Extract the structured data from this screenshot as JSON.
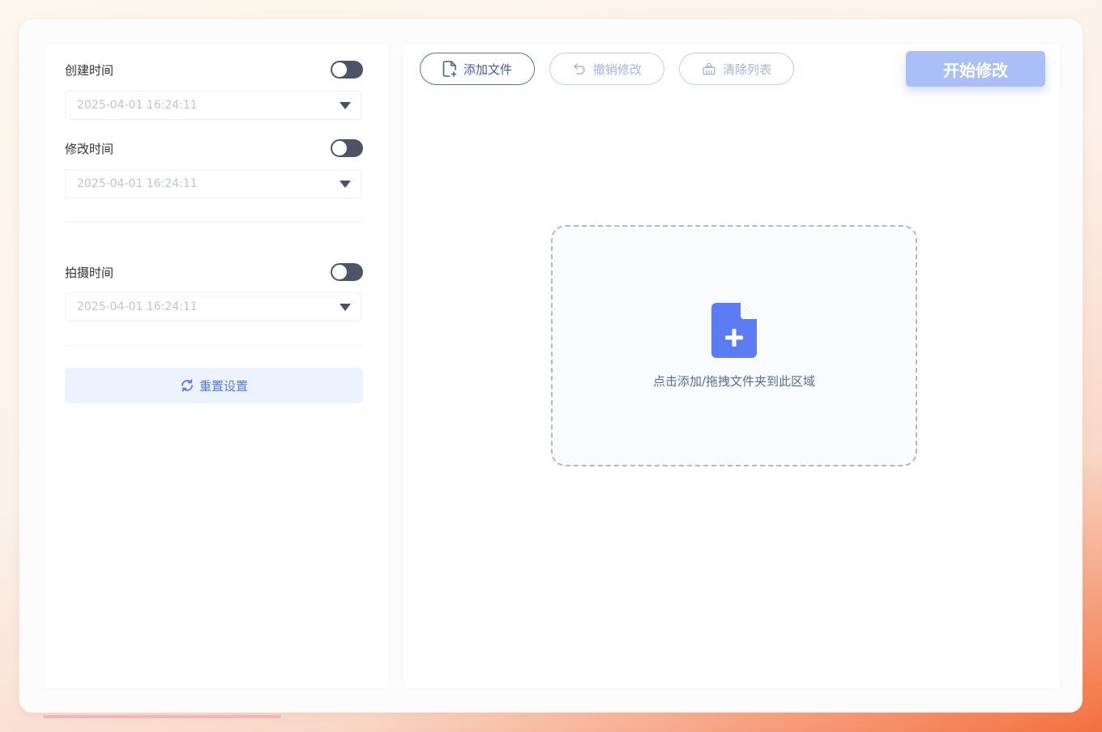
{
  "settings": {
    "created": {
      "label": "创建时间",
      "value": "2025-04-01 16:24:11",
      "enabled": false
    },
    "modified": {
      "label": "修改时间",
      "value": "2025-04-01 16:24:11",
      "enabled": false
    },
    "taken": {
      "label": "拍摄时间",
      "value": "2025-04-01 16:24:11",
      "enabled": false
    },
    "reset_label": "重置设置"
  },
  "toolbar": {
    "add_label": "添加文件",
    "undo_label": "撤销修改",
    "clear_label": "清除列表",
    "start_label": "开始修改"
  },
  "dropzone": {
    "text": "点击添加/拖拽文件夹到此区域",
    "icon": "file-add-icon"
  },
  "colors": {
    "accent": "#5b7cf3",
    "start_button": "#aabff8",
    "toggle_off": "#4e5366"
  }
}
